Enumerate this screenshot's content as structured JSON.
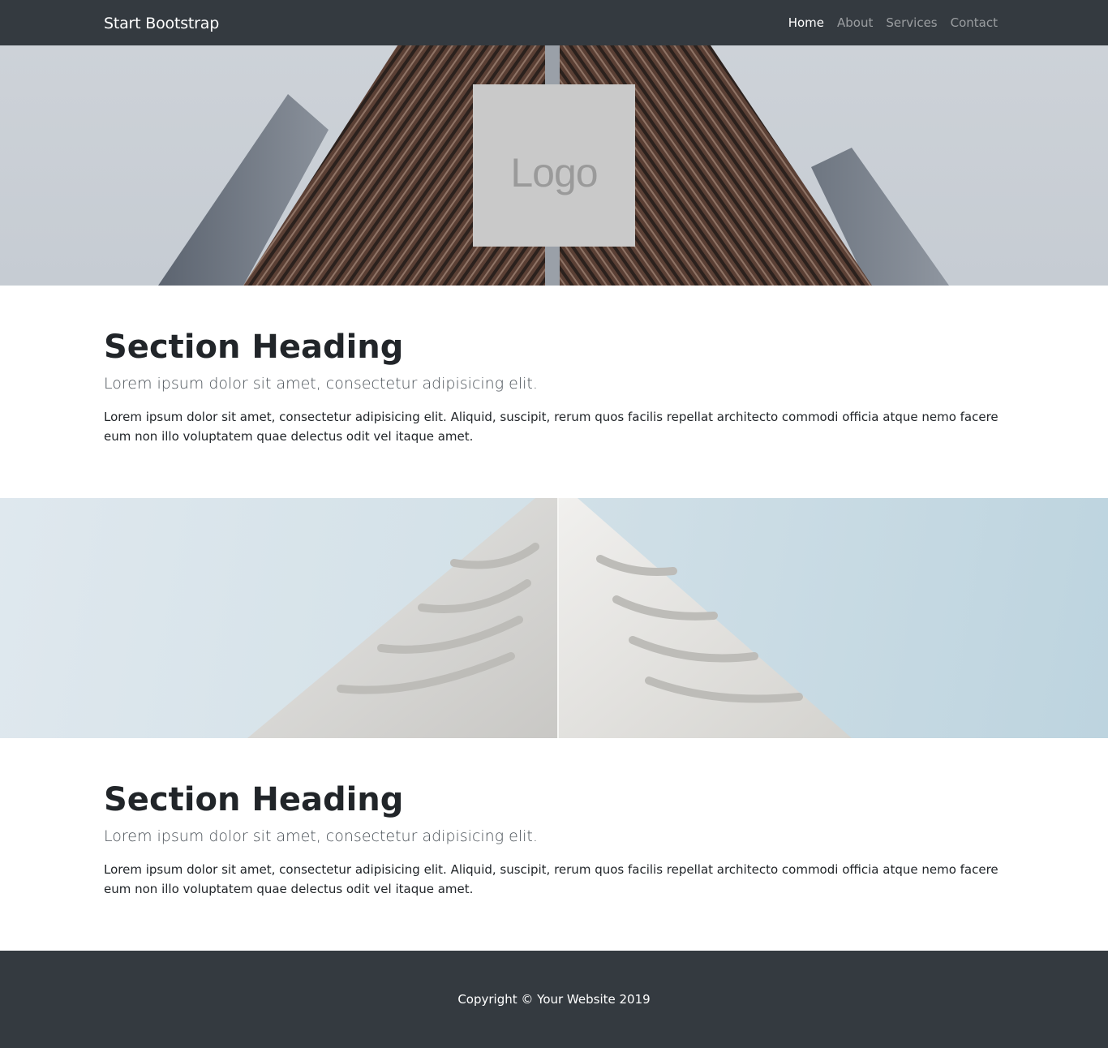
{
  "navbar": {
    "brand": "Start Bootstrap",
    "links": [
      {
        "label": "Home",
        "active": true
      },
      {
        "label": "About",
        "active": false
      },
      {
        "label": "Services",
        "active": false
      },
      {
        "label": "Contact",
        "active": false
      }
    ]
  },
  "hero1": {
    "logo_text": "Logo"
  },
  "sections": [
    {
      "heading": "Section Heading",
      "lead": "Lorem ipsum dolor sit amet, consectetur adipisicing elit.",
      "body": "Lorem ipsum dolor sit amet, consectetur adipisicing elit. Aliquid, suscipit, rerum quos facilis repellat architecto commodi officia atque nemo facere eum non illo voluptatem quae delectus odit vel itaque amet."
    },
    {
      "heading": "Section Heading",
      "lead": "Lorem ipsum dolor sit amet, consectetur adipisicing elit.",
      "body": "Lorem ipsum dolor sit amet, consectetur adipisicing elit. Aliquid, suscipit, rerum quos facilis repellat architecto commodi officia atque nemo facere eum non illo voluptatem quae delectus odit vel itaque amet."
    }
  ],
  "footer": {
    "copyright": "Copyright © Your Website 2019"
  },
  "colors": {
    "navbar_bg": "#343a40",
    "footer_bg": "#343a40",
    "logo_placeholder_bg": "#c9c9c9"
  }
}
